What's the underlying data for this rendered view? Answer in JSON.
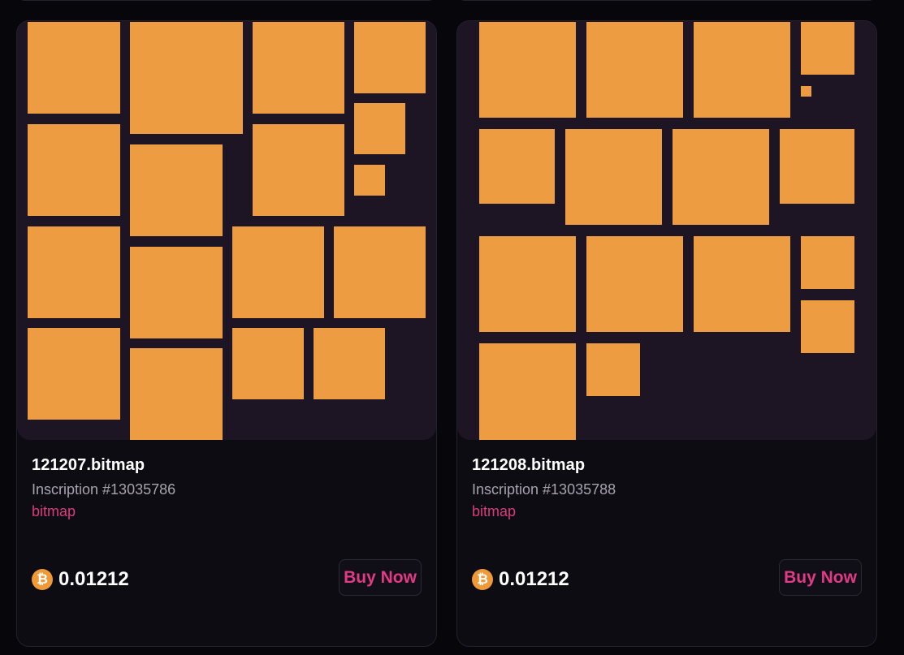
{
  "cards": [
    {
      "name": "121207.bitmap",
      "inscription": "Inscription #13035786",
      "collection": "bitmap",
      "price": "0.01212",
      "currency_icon": "bitcoin-icon",
      "button_label": "Buy Now"
    },
    {
      "name": "121208.bitmap",
      "inscription": "Inscription #13035788",
      "collection": "bitmap",
      "price": "0.01212",
      "currency_icon": "bitcoin-icon",
      "button_label": "Buy Now"
    }
  ],
  "colors": {
    "page_background": "#07060b",
    "card_background": "#0e0c13",
    "art_background": "#1d1524",
    "block_orange": "#ee9c41",
    "accent_pink": "#d63d7c",
    "bitcoin_orange": "#f09a37"
  }
}
